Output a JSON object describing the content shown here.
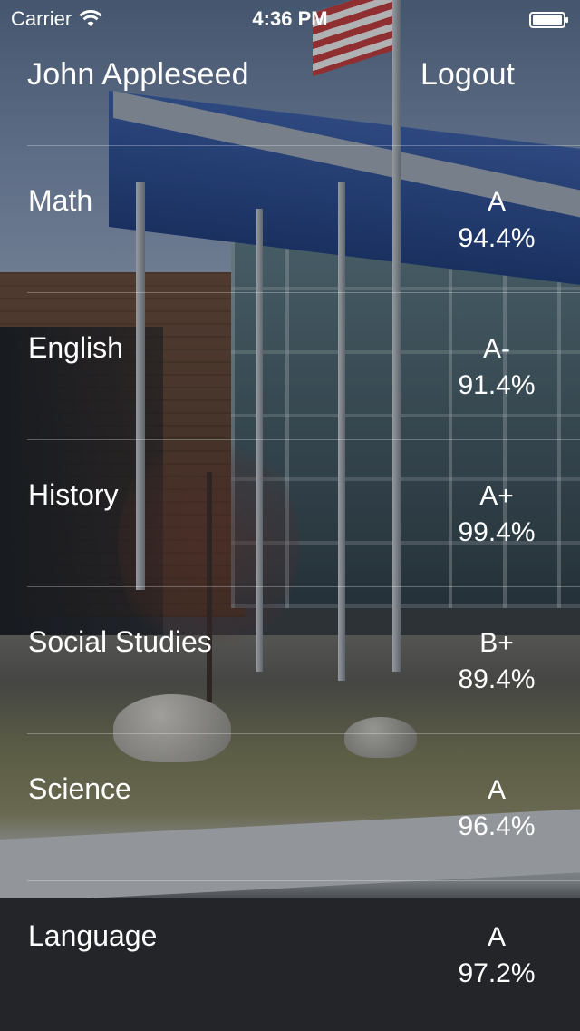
{
  "status_bar": {
    "carrier": "Carrier",
    "time": "4:36 PM"
  },
  "header": {
    "user_name": "John Appleseed",
    "logout_label": "Logout"
  },
  "courses": [
    {
      "name": "Math",
      "letter": "A",
      "percent": "94.4%"
    },
    {
      "name": "English",
      "letter": "A-",
      "percent": "91.4%"
    },
    {
      "name": "History",
      "letter": "A+",
      "percent": "99.4%"
    },
    {
      "name": "Social Studies",
      "letter": "B+",
      "percent": "89.4%"
    },
    {
      "name": "Science",
      "letter": "A",
      "percent": "96.4%"
    },
    {
      "name": "Language",
      "letter": "A",
      "percent": "97.2%"
    }
  ],
  "icons": {
    "wifi": "wifi-icon",
    "battery": "battery-icon"
  },
  "colors": {
    "text": "#ffffff",
    "separator": "rgba(255,255,255,0.28)"
  }
}
